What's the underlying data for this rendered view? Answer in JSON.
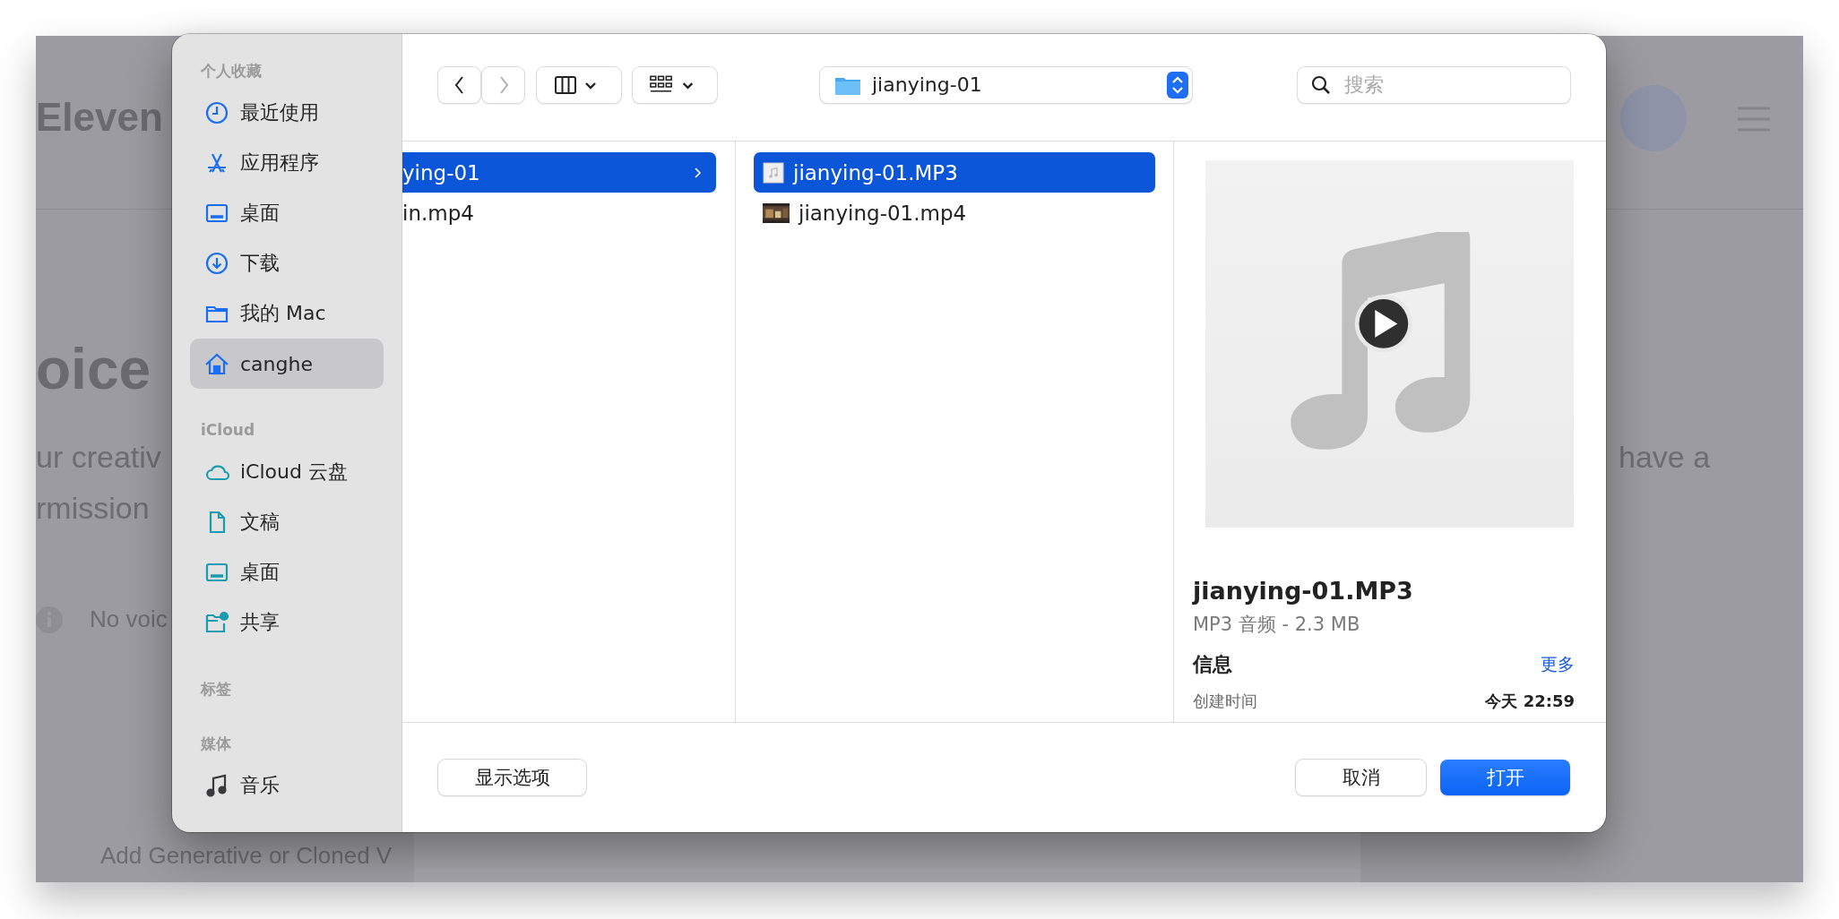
{
  "background": {
    "logo": "Eleven",
    "heading": "oice",
    "lines": [
      "ur creativ",
      "rmission"
    ],
    "notice": "No voic",
    "right_text": "have a",
    "footer": "Add Generative or Cloned V"
  },
  "dialog": {
    "sidebar": [
      {
        "title": "个人收藏",
        "color": "#1a6ef5",
        "items": [
          {
            "label": "最近使用",
            "kind": "clock",
            "selected": false
          },
          {
            "label": "应用程序",
            "kind": "apps",
            "selected": false
          },
          {
            "label": "桌面",
            "kind": "desktop",
            "selected": false
          },
          {
            "label": "下载",
            "kind": "download",
            "selected": false
          },
          {
            "label": "我的 Mac",
            "kind": "folder",
            "selected": false
          },
          {
            "label": "canghe",
            "kind": "home",
            "selected": true
          }
        ]
      },
      {
        "title": "iCloud",
        "color": "#1a9bb0",
        "items": [
          {
            "label": "iCloud 云盘",
            "kind": "cloud",
            "selected": false
          },
          {
            "label": "文稿",
            "kind": "document",
            "selected": false
          },
          {
            "label": "桌面",
            "kind": "desktop",
            "selected": false
          },
          {
            "label": "共享",
            "kind": "shared",
            "selected": false
          }
        ]
      },
      {
        "title": "标签"
      },
      {
        "title": "媒体",
        "color": "#3a3a3c",
        "items": [
          {
            "label": "音乐",
            "kind": "music",
            "selected": false
          }
        ]
      }
    ],
    "toolbar": {
      "back_enabled": true,
      "forward_enabled": false,
      "path": "jianying-01",
      "search_placeholder": "搜索"
    },
    "columns": [
      {
        "rows": [
          {
            "name": "ying-01",
            "has_children": true,
            "selected": true
          },
          {
            "name": "in.mp4",
            "has_children": false,
            "selected": false
          }
        ]
      },
      {
        "rows": [
          {
            "name": "jianying-01.MP3",
            "kind": "audio",
            "has_children": false,
            "selected": true
          },
          {
            "name": "jianying-01.mp4",
            "kind": "video",
            "has_children": false,
            "selected": false
          }
        ]
      }
    ],
    "preview": {
      "title": "jianying-01.MP3",
      "subtitle": "MP3 音频 - 2.3 MB",
      "info_heading": "信息",
      "more_link": "更多",
      "fields": [
        {
          "label": "创建时间",
          "value": "今天 22:59"
        }
      ]
    },
    "buttons": {
      "options": "显示选项",
      "cancel": "取消",
      "open": "打开"
    }
  }
}
